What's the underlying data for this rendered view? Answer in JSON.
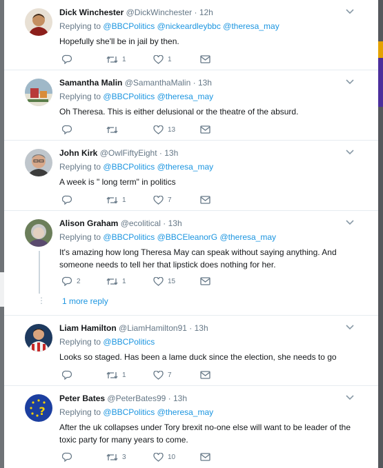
{
  "tweets": [
    {
      "name": "Dick Winchester",
      "handle": "@DickWinchester",
      "time": "12h",
      "replying_prefix": "Replying to",
      "replying_to": "@BBCPolitics @nickeardleybbc @theresa_may",
      "text": "Hopefully she'll be in jail by then.",
      "replies": "",
      "retweets": "1",
      "likes": "1",
      "avatar_colors": [
        "#c48f61",
        "#3b2a1c",
        "#8c1f1b"
      ]
    },
    {
      "name": "Samantha Malin",
      "handle": "@SamanthaMalin",
      "time": "13h",
      "replying_prefix": "Replying to",
      "replying_to": "@BBCPolitics @theresa_may",
      "text": "Oh Theresa. This is either delusional or the theatre of the absurd.",
      "replies": "",
      "retweets": "",
      "likes": "13",
      "avatar_colors": [
        "#9fb8c8",
        "#b83a3a",
        "#e6e2d3"
      ]
    },
    {
      "name": "John Kirk",
      "handle": "@OwlFiftyEight",
      "time": "13h",
      "replying_prefix": "Replying to",
      "replying_to": "@BBCPolitics @theresa_may",
      "text": "A week is \" long term\" in politics",
      "replies": "",
      "retweets": "1",
      "likes": "7",
      "avatar_colors": [
        "#d7a88a",
        "#7a7a7a",
        "#3c3c3c"
      ]
    },
    {
      "name": "Alison Graham",
      "handle": "@ecolitical",
      "time": "13h",
      "replying_prefix": "Replying to",
      "replying_to": "@BBCPolitics @BBCEleanorG @theresa_may",
      "text": "It's amazing how long Theresa May can speak without saying anything. And someone needs to tell her that lipstick does nothing for her.",
      "replies": "2",
      "retweets": "1",
      "likes": "15",
      "more_reply": "1 more reply",
      "avatar_colors": [
        "#e3d0c0",
        "#c9c9c9",
        "#6b7e5a"
      ]
    },
    {
      "name": "Liam Hamilton",
      "handle": "@LiamHamilton91",
      "time": "13h",
      "replying_prefix": "Replying to",
      "replying_to": "@BBCPolitics",
      "text": "Looks so staged. Has been a lame duck since the election, she needs to go",
      "replies": "",
      "retweets": "1",
      "likes": "7",
      "avatar_colors": [
        "#c62828",
        "#f2f2f2",
        "#1e3a5f"
      ]
    },
    {
      "name": "Peter Bates",
      "handle": "@PeterBates99",
      "time": "13h",
      "replying_prefix": "Replying to",
      "replying_to": "@BBCPolitics @theresa_may",
      "text": "After the uk collapses under Tory brexit no-one else will want to be leader of the toxic party for many years to come.",
      "replies": "",
      "retweets": "3",
      "likes": "10",
      "avatar_colors": [
        "#1c3fa0",
        "#f5d000",
        "#f5d000"
      ]
    }
  ],
  "icons": {
    "reply": "reply-icon",
    "retweet": "retweet-icon",
    "like": "heart-icon",
    "message": "envelope-icon",
    "caret": "chevron-down-icon"
  },
  "colors": {
    "link": "#1b95e0",
    "meta": "#657786",
    "text": "#14171a"
  }
}
